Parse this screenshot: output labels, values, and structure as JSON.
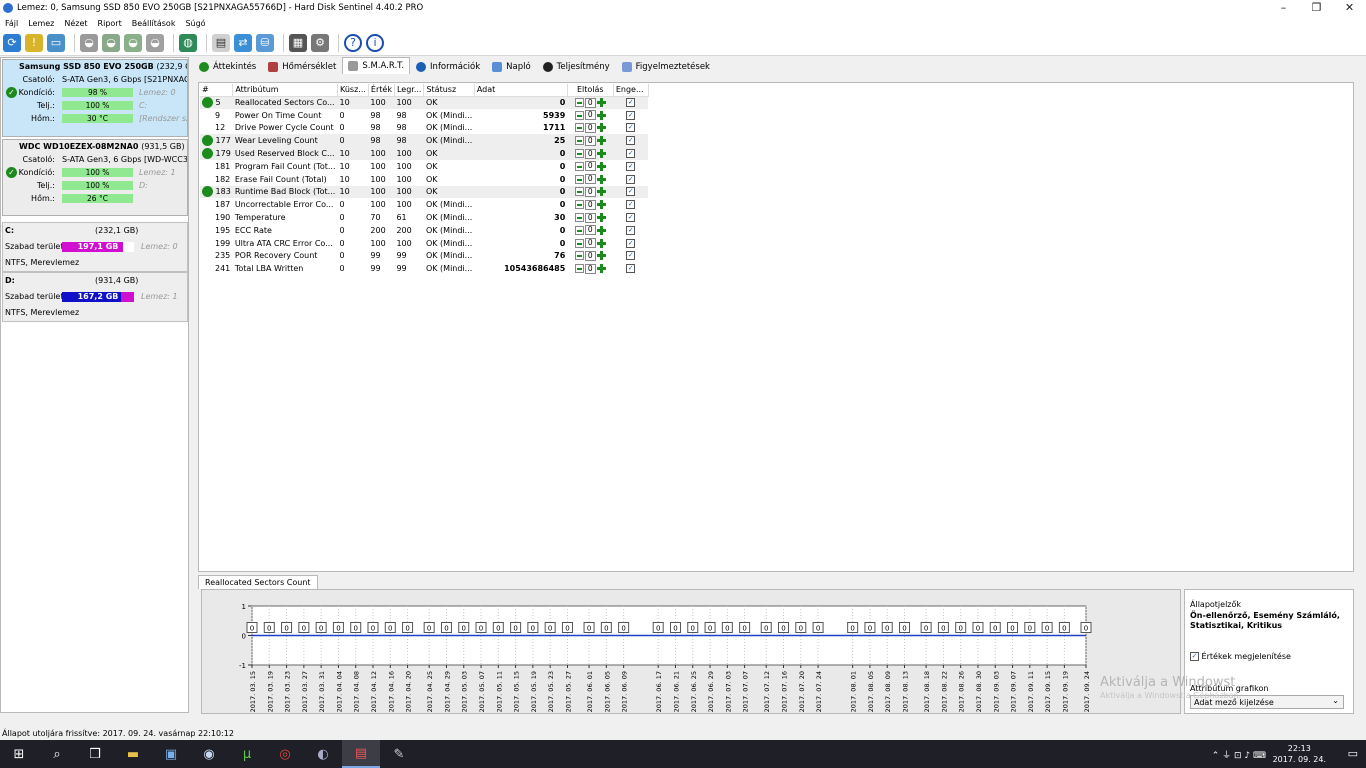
{
  "window": {
    "title": "Lemez: 0, Samsung SSD 850 EVO 250GB [S21PNXAGA55766D]  -  Hard Disk Sentinel 4.40.2 PRO"
  },
  "menu": [
    "Fájl",
    "Lemez",
    "Nézet",
    "Riport",
    "Beállítások",
    "Súgó"
  ],
  "disks": [
    {
      "name": "Samsung SSD 850 EVO 250GB",
      "size": "(232,9 GB)",
      "iface_label": "Csatoló:",
      "iface": "S-ATA Gen3, 6 Gbps [S21PNXAGA",
      "cond_label": "Kondíció:",
      "cond": "98 %",
      "cond_pct": 98,
      "cond_side": "Lemez: 0",
      "perf_label": "Telj.:",
      "perf": "100 %",
      "perf_pct": 100,
      "perf_side": "C:",
      "temp_label": "Hőm.:",
      "temp": "30 °C",
      "temp_side": "[Rendszer sza"
    },
    {
      "name": "WDC WD10EZEX-08M2NA0",
      "size": "(931,5 GB)",
      "iface_label": "Csatoló:",
      "iface": "S-ATA Gen3, 6 Gbps [WD-WCC3F",
      "cond_label": "Kondíció:",
      "cond": "100 %",
      "cond_pct": 100,
      "cond_side": "Lemez: 1",
      "perf_label": "Telj.:",
      "perf": "100 %",
      "perf_pct": 100,
      "perf_side": "D:",
      "temp_label": "Hőm.:",
      "temp": "26 °C",
      "temp_side": ""
    }
  ],
  "volumes": [
    {
      "letter": "C:",
      "size": "(232,1 GB)",
      "free_label": "Szabad terület",
      "free": "197,1 GB",
      "side": "Lemez: 0",
      "fs": "NTFS, Merevlemez",
      "color": "#d10fd1",
      "free_pct": 85
    },
    {
      "letter": "D:",
      "size": "(931,4 GB)",
      "free_label": "Szabad terület",
      "free": "167,2 GB",
      "side": "Lemez: 1",
      "fs": "NTFS, Merevlemez",
      "color": "#1010c8",
      "free_pct": 18
    }
  ],
  "tabs": [
    "Áttekintés",
    "Hőmérséklet",
    "S.M.A.R.T.",
    "Információk",
    "Napló",
    "Teljesítmény",
    "Figyelmeztetések"
  ],
  "smart": {
    "headers": [
      "#",
      "Attribútum",
      "Küsz...",
      "Érték",
      "Legr...",
      "Státusz",
      "Adat",
      "Eltolás",
      "Enge..."
    ],
    "rows": [
      {
        "id": "5",
        "name": "Reallocated Sectors Co...",
        "thr": "10",
        "val": "100",
        "worst": "100",
        "status": "OK",
        "data": "0",
        "offset": "0",
        "icon": true
      },
      {
        "id": "9",
        "name": "Power On Time Count",
        "thr": "0",
        "val": "98",
        "worst": "98",
        "status": "OK (Mindi...",
        "data": "5939",
        "offset": "0",
        "icon": false
      },
      {
        "id": "12",
        "name": "Drive Power Cycle Count",
        "thr": "0",
        "val": "98",
        "worst": "98",
        "status": "OK (Mindi...",
        "data": "1711",
        "offset": "0",
        "icon": false
      },
      {
        "id": "177",
        "name": "Wear Leveling Count",
        "thr": "0",
        "val": "98",
        "worst": "98",
        "status": "OK (Mindi...",
        "data": "25",
        "offset": "0",
        "icon": true
      },
      {
        "id": "179",
        "name": "Used Reserved Block C...",
        "thr": "10",
        "val": "100",
        "worst": "100",
        "status": "OK",
        "data": "0",
        "offset": "0",
        "icon": true
      },
      {
        "id": "181",
        "name": "Program Fail Count (Tot...",
        "thr": "10",
        "val": "100",
        "worst": "100",
        "status": "OK",
        "data": "0",
        "offset": "0",
        "icon": false
      },
      {
        "id": "182",
        "name": "Erase Fail Count (Total)",
        "thr": "10",
        "val": "100",
        "worst": "100",
        "status": "OK",
        "data": "0",
        "offset": "0",
        "icon": false
      },
      {
        "id": "183",
        "name": "Runtime Bad Block (Tot...",
        "thr": "10",
        "val": "100",
        "worst": "100",
        "status": "OK",
        "data": "0",
        "offset": "0",
        "icon": true
      },
      {
        "id": "187",
        "name": "Uncorrectable Error Co...",
        "thr": "0",
        "val": "100",
        "worst": "100",
        "status": "OK (Mindi...",
        "data": "0",
        "offset": "0",
        "icon": false
      },
      {
        "id": "190",
        "name": "Temperature",
        "thr": "0",
        "val": "70",
        "worst": "61",
        "status": "OK (Mindi...",
        "data": "30",
        "offset": "0",
        "icon": false
      },
      {
        "id": "195",
        "name": "ECC Rate",
        "thr": "0",
        "val": "200",
        "worst": "200",
        "status": "OK (Mindi...",
        "data": "0",
        "offset": "0",
        "icon": false
      },
      {
        "id": "199",
        "name": "Ultra ATA CRC Error Co...",
        "thr": "0",
        "val": "100",
        "worst": "100",
        "status": "OK (Mindi...",
        "data": "0",
        "offset": "0",
        "icon": false
      },
      {
        "id": "235",
        "name": "POR Recovery Count",
        "thr": "0",
        "val": "99",
        "worst": "99",
        "status": "OK (Mindi...",
        "data": "76",
        "offset": "0",
        "icon": false
      },
      {
        "id": "241",
        "name": "Total LBA Written",
        "thr": "0",
        "val": "99",
        "worst": "99",
        "status": "OK (Mindi...",
        "data": "10543686485",
        "offset": "0",
        "icon": false
      }
    ]
  },
  "graph": {
    "tab": "Reallocated Sectors Count",
    "side_title": "Állapotjelzők",
    "side_desc": "Ön-ellenőrző, Esemény Számláló, Statisztikai, Kritikus",
    "show_values": "Értékek megjelenítése",
    "graph_label": "Attribútum grafikon",
    "graph_select": "Adat mező kijelzése"
  },
  "chart_data": {
    "type": "line",
    "y_ticks": [
      "1",
      "0",
      "-1"
    ],
    "ylim": [
      -1,
      1
    ],
    "x": [
      "2017. 03. 15",
      "2017. 03. 19",
      "2017. 03. 23",
      "2017. 03. 27",
      "2017. 03. 31",
      "2017. 04. 04",
      "2017. 04. 08",
      "2017. 04. 12",
      "2017. 04. 16",
      "2017. 04. 20",
      "2017. 04. 25",
      "2017. 04. 29",
      "2017. 05. 03",
      "2017. 05. 07",
      "2017. 05. 11",
      "2017. 05. 15",
      "2017. 05. 19",
      "2017. 05. 23",
      "2017. 05. 27",
      "2017. 06. 01",
      "2017. 06. 05",
      "2017. 06. 09",
      "2017. 06. 17",
      "2017. 06. 21",
      "2017. 06. 25",
      "2017. 06. 29",
      "2017. 07. 03",
      "2017. 07. 07",
      "2017. 07. 12",
      "2017. 07. 16",
      "2017. 07. 20",
      "2017. 07. 24",
      "2017. 08. 01",
      "2017. 08. 05",
      "2017. 08. 09",
      "2017. 08. 13",
      "2017. 08. 18",
      "2017. 08. 22",
      "2017. 08. 26",
      "2017. 08. 30",
      "2017. 09. 03",
      "2017. 09. 07",
      "2017. 09. 11",
      "2017. 09. 15",
      "2017. 09. 19",
      "2017. 09. 24"
    ],
    "values": [
      0,
      0,
      0,
      0,
      0,
      0,
      0,
      0,
      0,
      0,
      0,
      0,
      0,
      0,
      0,
      0,
      0,
      0,
      0,
      0,
      0,
      0,
      0,
      0,
      0,
      0,
      0,
      0,
      0,
      0,
      0,
      0,
      0,
      0,
      0,
      0,
      0,
      0,
      0,
      0,
      0,
      0,
      0,
      0,
      0,
      0
    ],
    "grid": true
  },
  "status": "Állapot utoljára frissítve: 2017. 09. 24. vasárnap 22:10:12",
  "watermark": {
    "line1": "Aktiválja a Windowst",
    "line2": "Aktiválja a Windowst a Gépházban."
  },
  "clock": {
    "time": "22:13",
    "date": "2017. 09. 24."
  }
}
